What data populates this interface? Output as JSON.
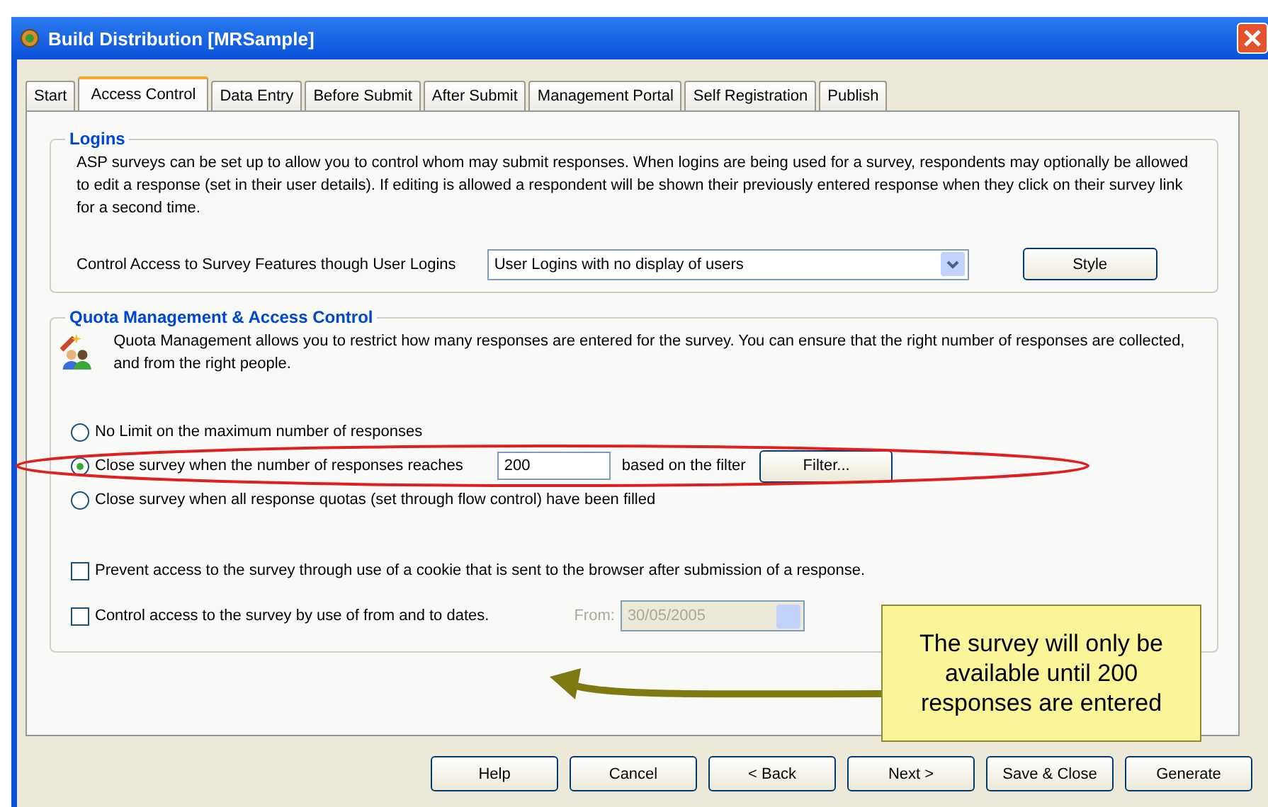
{
  "window": {
    "title": "Build Distribution [MRSample]"
  },
  "tabs": [
    {
      "label": "Start",
      "selected": false
    },
    {
      "label": "Access Control",
      "selected": true
    },
    {
      "label": "Data Entry",
      "selected": false
    },
    {
      "label": "Before Submit",
      "selected": false
    },
    {
      "label": "After Submit",
      "selected": false
    },
    {
      "label": "Management Portal",
      "selected": false
    },
    {
      "label": "Self Registration",
      "selected": false
    },
    {
      "label": "Publish",
      "selected": false
    }
  ],
  "logins": {
    "title": "Logins",
    "description": "ASP surveys can be set up to allow you to control whom may submit responses. When logins are being used for a survey, respondents may optionally be allowed to edit a response (set in their user details). If editing is allowed a respondent will be shown their previously entered response when they click on their survey link for a second time.",
    "control_label": "Control Access to Survey Features though User Logins",
    "dropdown_value": "User Logins with no display of users",
    "style_button": "Style"
  },
  "quota": {
    "title": "Quota Management & Access Control",
    "description": "Quota Management allows you to restrict how many responses are entered for the survey. You can ensure that the right number of responses are collected, and from the right people.",
    "options": [
      {
        "label": "No Limit on the maximum number of responses",
        "selected": false
      },
      {
        "label": "Close survey when the number of responses reaches",
        "selected": true,
        "value": "200",
        "suffix": "based on the filter",
        "button": "Filter..."
      },
      {
        "label": "Close survey when all response quotas (set through flow control) have been filled",
        "selected": false
      }
    ],
    "checks": [
      {
        "label": "Prevent access to the survey through use of a cookie that is sent to the browser after submission of a response.",
        "checked": false
      },
      {
        "label": "Control access to the survey by use of from and to dates.",
        "checked": false,
        "from_label": "From:",
        "from_value": "30/05/2005"
      }
    ]
  },
  "callout": "The survey will only be available until 200 responses are entered",
  "buttons": [
    "Help",
    "Cancel",
    "< Back",
    "Next >",
    "Save & Close",
    "Generate"
  ]
}
